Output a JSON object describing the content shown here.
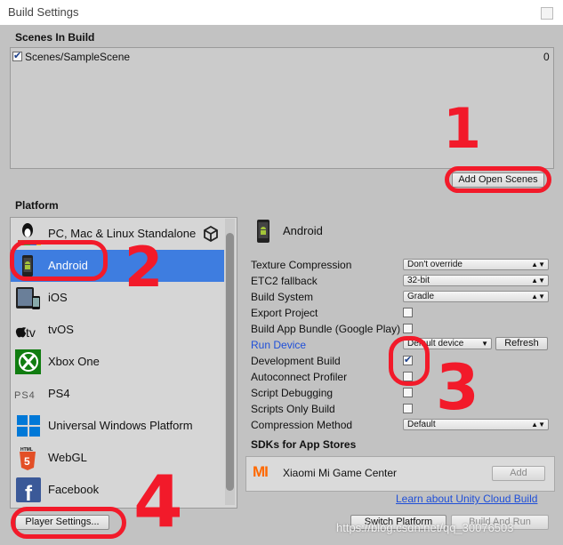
{
  "window": {
    "title": "Build Settings"
  },
  "scenes": {
    "header": "Scenes In Build",
    "items": [
      {
        "name": "Scenes/SampleScene",
        "index": "0",
        "checked": true
      }
    ],
    "add_open_scenes_label": "Add Open Scenes"
  },
  "platform": {
    "header": "Platform",
    "items": [
      {
        "label": "PC, Mac & Linux Standalone",
        "icon": "pc-mac-linux-icon"
      },
      {
        "label": "Android",
        "icon": "android-icon",
        "selected": true
      },
      {
        "label": "iOS",
        "icon": "ios-icon"
      },
      {
        "label": "tvOS",
        "icon": "tvos-icon"
      },
      {
        "label": "Xbox One",
        "icon": "xbox-icon"
      },
      {
        "label": "PS4",
        "icon": "ps4-icon"
      },
      {
        "label": "Universal Windows Platform",
        "icon": "windows-icon"
      },
      {
        "label": "WebGL",
        "icon": "webgl-icon"
      },
      {
        "label": "Facebook",
        "icon": "facebook-icon"
      }
    ]
  },
  "settings": {
    "platform_title": "Android",
    "texture_compression": {
      "label": "Texture Compression",
      "value": "Don't override"
    },
    "etc2_fallback": {
      "label": "ETC2 fallback",
      "value": "32-bit"
    },
    "build_system": {
      "label": "Build System",
      "value": "Gradle"
    },
    "export_project": {
      "label": "Export Project",
      "checked": false
    },
    "build_app_bundle": {
      "label": "Build App Bundle (Google Play)",
      "checked": false
    },
    "run_device": {
      "label": "Run Device",
      "value": "Default device",
      "refresh_label": "Refresh"
    },
    "development_build": {
      "label": "Development Build",
      "checked": true
    },
    "autoconnect_profiler": {
      "label": "Autoconnect Profiler",
      "checked": false
    },
    "script_debugging": {
      "label": "Script Debugging",
      "checked": false
    },
    "scripts_only_build": {
      "label": "Scripts Only Build",
      "checked": false
    },
    "compression_method": {
      "label": "Compression Method",
      "value": "Default"
    }
  },
  "sdks": {
    "header": "SDKs for App Stores",
    "items": [
      {
        "logo": "MI",
        "name": "Xiaomi Mi Game Center",
        "add_label": "Add"
      }
    ]
  },
  "footer": {
    "cloud_build_link": "Learn about Unity Cloud Build",
    "player_settings_label": "Player Settings...",
    "switch_platform_label": "Switch Platform",
    "build_and_run_label": "Build And Run"
  },
  "watermark": "https://blog.csdn.net/qq_30076503",
  "annotations": {
    "a1": "1",
    "a2": "2",
    "a3": "3",
    "a4": "4"
  },
  "colors": {
    "selection": "#3e7de0",
    "link": "#1f4fd8",
    "annotation": "#f21a2a"
  }
}
